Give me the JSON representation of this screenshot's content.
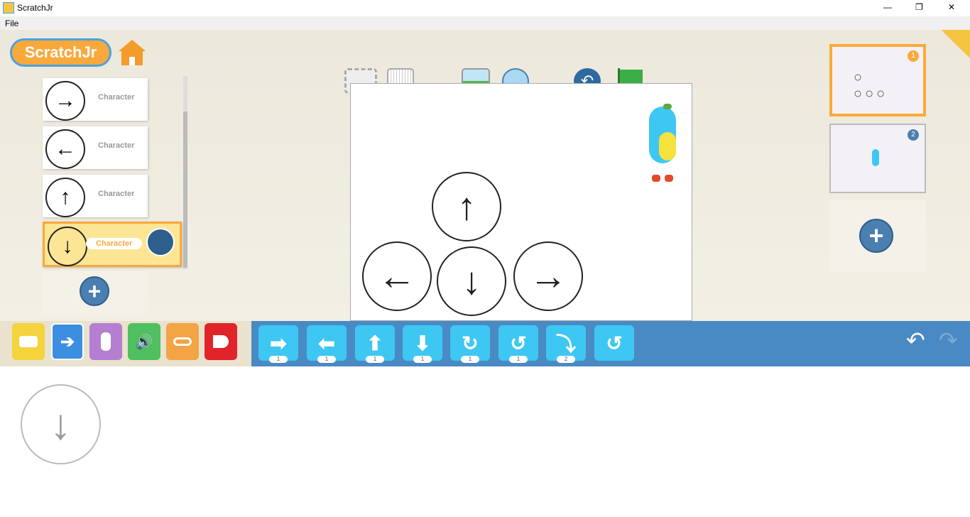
{
  "window": {
    "title": "ScratchJr",
    "minimize": "—",
    "maximize": "❐",
    "close": "✕"
  },
  "menu": {
    "file": "File"
  },
  "logo": "ScratchJr",
  "sprites": [
    {
      "name": "Character",
      "arrow": "→"
    },
    {
      "name": "Character",
      "arrow": "←"
    },
    {
      "name": "Character",
      "arrow": "↑"
    },
    {
      "name": "Character",
      "arrow": "↓",
      "selected": true
    }
  ],
  "add_symbol": "+",
  "stage_arrows": {
    "up": "↑",
    "left": "←",
    "down": "↓",
    "right": "→"
  },
  "pages": [
    {
      "number": "1",
      "selected": true
    },
    {
      "number": "2"
    }
  ],
  "categories": [
    {
      "name": "triggering",
      "color": "#f5d33c"
    },
    {
      "name": "motion",
      "color": "#3b8ee0",
      "glyph": "➔"
    },
    {
      "name": "looks",
      "color": "#b57ed0"
    },
    {
      "name": "sound",
      "color": "#4fbf5f"
    },
    {
      "name": "control",
      "color": "#f3a445"
    },
    {
      "name": "end",
      "color": "#e0242a"
    }
  ],
  "blocks": [
    {
      "name": "move-right",
      "glyph": "➡",
      "count": "1"
    },
    {
      "name": "move-left",
      "glyph": "⬅",
      "count": "1"
    },
    {
      "name": "move-up",
      "glyph": "⬆",
      "count": "1"
    },
    {
      "name": "move-down",
      "glyph": "⬇",
      "count": "1"
    },
    {
      "name": "turn-right",
      "glyph": "↻",
      "count": "1"
    },
    {
      "name": "turn-left",
      "glyph": "↺",
      "count": "1"
    },
    {
      "name": "hop",
      "glyph": "⤵",
      "count": "2"
    },
    {
      "name": "go-home",
      "glyph": "↺"
    }
  ],
  "undo": "↶",
  "redo": "↷",
  "script_preview_arrow": "↓"
}
